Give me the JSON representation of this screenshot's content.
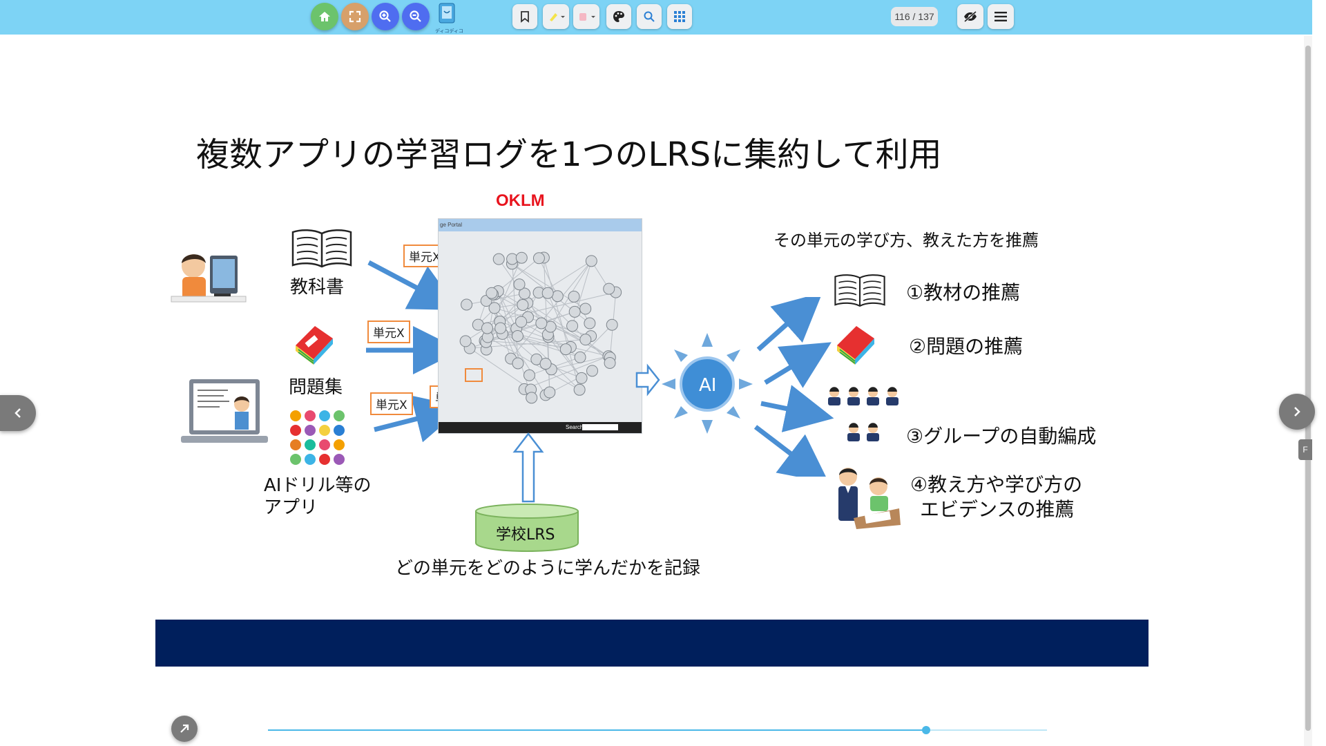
{
  "toolbar": {
    "page_counter": "116 / 137",
    "logo_text": "ディコディコ",
    "buttons": [
      "home-icon",
      "fullscreen-icon",
      "zoom-in-icon",
      "zoom-out-icon",
      "bookmark-icon",
      "highlighter-icon",
      "marker-icon",
      "palette-icon",
      "search-icon",
      "grid-icon",
      "hide-icon",
      "menu-icon"
    ],
    "colors": {
      "bar": "#7dd3f5",
      "home": "#6cc36c",
      "fullscreen": "#d7a06a",
      "zoom": "#4f6df0"
    }
  },
  "slide": {
    "title": "複数アプリの学習ログを1つのLRSに集約して利用",
    "oklm_label": "OKLM",
    "portal_header": "ge Portal",
    "portal_search": "Search",
    "left_items": {
      "textbook": "教科書",
      "workbook": "問題集",
      "apps_line1": "AIドリル等の",
      "apps_line2": "アプリ"
    },
    "unit_label": "単元X",
    "lrs_label": "学校LRS",
    "record_caption": "どの単元をどのように学んだかを記録",
    "ai_label": "AI",
    "right_header": "その単元の学び方、教えた方を推薦",
    "recommendations": [
      "①教材の推薦",
      "②問題の推薦",
      "③グループの自動編成",
      "④教え方や学び方の",
      "エビデンスの推薦"
    ],
    "footer_color": "#001f5c"
  },
  "viewer": {
    "progress_fraction": 0.845
  }
}
